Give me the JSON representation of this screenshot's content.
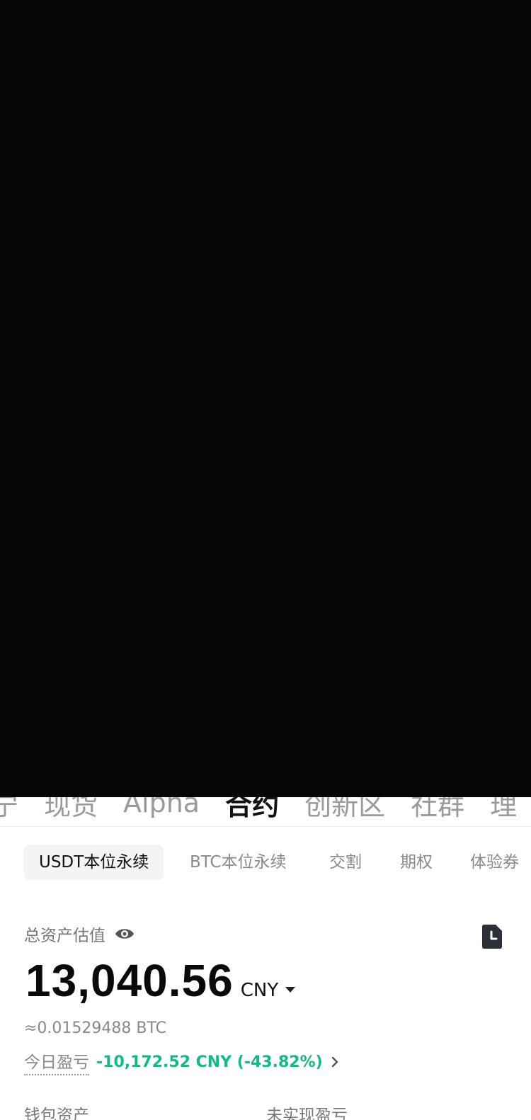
{
  "top_tabs": [
    "宁",
    "现货",
    "Alpha",
    "合约",
    "创新区",
    "社群",
    "理"
  ],
  "top_tabs_active_index": 3,
  "sub_tabs": [
    "USDT本位永续",
    "BTC本位永续",
    "交割",
    "期权",
    "体验券"
  ],
  "sub_tabs_active_index": 0,
  "assets": {
    "label": "总资产估值",
    "amount": "13,040.56",
    "currency": "CNY",
    "btc_equiv": "≈0.01529488 BTC",
    "today_pnl_label": "今日盈亏",
    "today_pnl_value": "-10,172.52 CNY (-43.82%)"
  },
  "bottom": {
    "wallet_label": "钱包资产",
    "unrealized_label": "未实现盈亏"
  },
  "colors": {
    "positive_green": "#0ebd83",
    "chip_bg": "#f3f4f6"
  },
  "icons": {
    "eye": "eye-icon",
    "record": "record-icon",
    "caret": "caret-down-icon",
    "chevron": "chevron-right-icon"
  }
}
